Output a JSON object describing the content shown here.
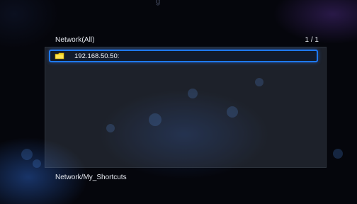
{
  "top_strip": {
    "partial_text": "g"
  },
  "browser": {
    "title": "Network(All)",
    "page_counter": "1 / 1",
    "items": [
      {
        "label": "192.168.50.50:",
        "icon": "folder-icon",
        "selected": true
      }
    ],
    "path": "Network/My_Shortcuts"
  },
  "colors": {
    "selection_border": "#1e79ff",
    "text": "#e6e9f0"
  }
}
